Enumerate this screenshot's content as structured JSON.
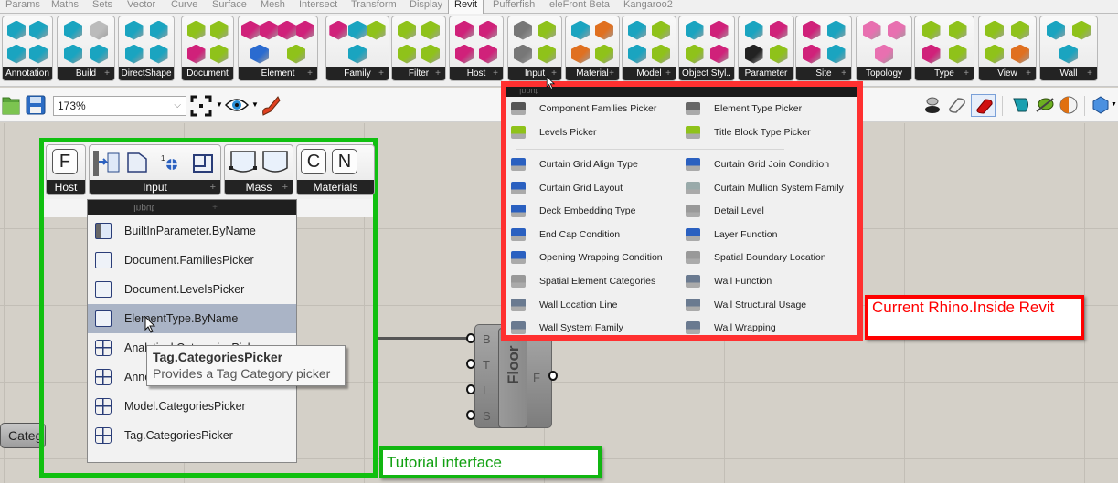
{
  "tabs": [
    {
      "label": "Params",
      "active": false
    },
    {
      "label": "Maths",
      "active": false
    },
    {
      "label": "Sets",
      "active": false
    },
    {
      "label": "Vector",
      "active": false
    },
    {
      "label": "Curve",
      "active": false
    },
    {
      "label": "Surface",
      "active": false
    },
    {
      "label": "Mesh",
      "active": false
    },
    {
      "label": "Intersect",
      "active": false
    },
    {
      "label": "Transform",
      "active": false
    },
    {
      "label": "Display",
      "active": false
    },
    {
      "label": "Revit",
      "active": true
    },
    {
      "label": "Pufferfish",
      "active": false
    },
    {
      "label": "eleFront Beta",
      "active": false
    },
    {
      "label": "Kangaroo2",
      "active": false
    }
  ],
  "ribbon_panels": [
    {
      "label": "Annotation",
      "has_expand": false
    },
    {
      "label": "Build",
      "has_expand": true
    },
    {
      "label": "DirectShape",
      "has_expand": false
    },
    {
      "label": "Document",
      "has_expand": false
    },
    {
      "label": "Element",
      "has_expand": true
    },
    {
      "label": "Family",
      "has_expand": true
    },
    {
      "label": "Filter",
      "has_expand": true
    },
    {
      "label": "Host",
      "has_expand": true
    },
    {
      "label": "Input",
      "has_expand": true
    },
    {
      "label": "Material",
      "has_expand": true
    },
    {
      "label": "Model",
      "has_expand": true
    },
    {
      "label": "Object Styl..",
      "has_expand": false
    },
    {
      "label": "Parameter",
      "has_expand": false
    },
    {
      "label": "Site",
      "has_expand": true
    },
    {
      "label": "Topology",
      "has_expand": false
    },
    {
      "label": "Type",
      "has_expand": true
    },
    {
      "label": "View",
      "has_expand": true
    },
    {
      "label": "Wall",
      "has_expand": true
    }
  ],
  "toolbar": {
    "open_icon": "folder-open-icon",
    "save_icon": "save-disk-icon",
    "zoom_value": "173%",
    "zoom_extents_icon": "zoom-extents-icon",
    "preview_icon": "eye-icon",
    "sketch_icon": "pen-sketch-icon",
    "right_icons": [
      "preview-off-icon",
      "preview-wireframe-icon",
      "preview-shaded-icon",
      "preview-selected-icon",
      "preview-mesh-icon",
      "document-preview-icon",
      "preview-settings-icon"
    ]
  },
  "current_menu": {
    "header": "Input",
    "top_items": [
      {
        "label": "Component Families Picker",
        "icon": "component-families-icon"
      },
      {
        "label": "Element Type Picker",
        "icon": "element-type-icon"
      },
      {
        "label": "Levels Picker",
        "icon": "levels-icon"
      },
      {
        "label": "Title Block Type Picker",
        "icon": "title-block-icon"
      }
    ],
    "items": [
      {
        "label": "Curtain Grid Align Type",
        "icon": "curtain-grid-icon"
      },
      {
        "label": "Curtain Grid Join Condition",
        "icon": "curtain-grid-icon"
      },
      {
        "label": "Curtain Grid Layout",
        "icon": "curtain-grid-icon"
      },
      {
        "label": "Curtain Mullion System Family",
        "icon": "curtain-mullion-icon"
      },
      {
        "label": "Deck Embedding Type",
        "icon": "deck-icon"
      },
      {
        "label": "Detail Level",
        "icon": "detail-level-icon"
      },
      {
        "label": "End Cap Condition",
        "icon": "deck-icon"
      },
      {
        "label": "Layer Function",
        "icon": "deck-icon"
      },
      {
        "label": "Opening Wrapping Condition",
        "icon": "deck-icon"
      },
      {
        "label": "Spatial Boundary Location",
        "icon": "detail-level-icon"
      },
      {
        "label": "Spatial Element Categories",
        "icon": "detail-level-icon"
      },
      {
        "label": "Wall Function",
        "icon": "wall-icon"
      },
      {
        "label": "Wall Location Line",
        "icon": "wall-icon"
      },
      {
        "label": "Wall Structural Usage",
        "icon": "wall-icon"
      },
      {
        "label": "Wall System Family",
        "icon": "wall-icon"
      },
      {
        "label": "Wall Wrapping",
        "icon": "wall-icon"
      }
    ]
  },
  "annotations": {
    "current": "Current Rhino.Inside Revit",
    "tutorial": "Tutorial interface"
  },
  "tutorial": {
    "panels": [
      {
        "label": "Host",
        "keys": [
          "F"
        ]
      },
      {
        "label": "Input",
        "has_expand": true
      },
      {
        "label": "Mass",
        "has_expand": true
      },
      {
        "label": "Materials",
        "keys": [
          "C",
          "N"
        ]
      }
    ],
    "menu_header": "Input",
    "menu_items": [
      {
        "label": "BuiltInParameter.ByName",
        "icon": "builtin-parameter-icon",
        "hovered": false
      },
      {
        "label": "Document.FamiliesPicker",
        "icon": "families-picker-icon",
        "hovered": false
      },
      {
        "label": "Document.LevelsPicker",
        "icon": "levels-picker-icon",
        "hovered": false
      },
      {
        "label": "ElementType.ByName",
        "icon": "element-type-icon",
        "hovered": true
      },
      {
        "label": "Analytical.CategoriesPicker",
        "icon": "categories-grid-icon",
        "hovered": false
      },
      {
        "label": "Annotation.CategoriesPicker",
        "icon": "categories-grid-icon",
        "hovered": false
      },
      {
        "label": "Model.CategoriesPicker",
        "icon": "categories-grid-icon",
        "hovered": false
      },
      {
        "label": "Tag.CategoriesPicker",
        "icon": "categories-grid-icon",
        "hovered": false
      }
    ],
    "tooltip": {
      "title": "Tag.CategoriesPicker",
      "description": "Provides a Tag Category picker"
    }
  },
  "canvas": {
    "floor_component": {
      "name": "Floor",
      "inputs": [
        "B",
        "T",
        "L",
        "S"
      ],
      "outputs": [
        "F"
      ]
    },
    "categ_component": {
      "label": "Categ"
    }
  }
}
